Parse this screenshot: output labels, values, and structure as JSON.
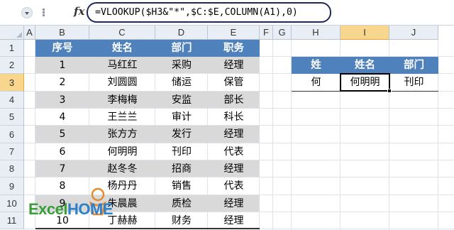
{
  "formula_bar": {
    "fx_label": "fx",
    "formula": "=VLOOKUP($H3&\"*\",$C:$E,COLUMN(A1),0)"
  },
  "columns": [
    "A",
    "B",
    "C",
    "D",
    "E",
    "F",
    "G",
    "H",
    "I",
    "J"
  ],
  "rows": [
    "1",
    "2",
    "3",
    "4",
    "5",
    "6",
    "7",
    "8",
    "9",
    "10",
    "11"
  ],
  "selected": {
    "column": "I",
    "row": "3"
  },
  "table": {
    "headers": [
      "序号",
      "姓名",
      "部门",
      "职务"
    ],
    "rows": [
      [
        "1",
        "马红红",
        "采购",
        "经理"
      ],
      [
        "2",
        "刘圆圆",
        "储运",
        "保管"
      ],
      [
        "3",
        "李梅梅",
        "安监",
        "部长"
      ],
      [
        "4",
        "王兰兰",
        "审计",
        "科长"
      ],
      [
        "5",
        "张方方",
        "发行",
        "经理"
      ],
      [
        "6",
        "何明明",
        "刊印",
        "代表"
      ],
      [
        "7",
        "赵冬冬",
        "招商",
        "经理"
      ],
      [
        "8",
        "杨丹丹",
        "销售",
        "代表"
      ],
      [
        "9",
        "朱晨晨",
        "质检",
        "经理"
      ],
      [
        "10",
        "丁赫赫",
        "财务",
        "经理"
      ]
    ]
  },
  "lookup": {
    "headers": [
      "姓",
      "姓名",
      "部门"
    ],
    "values": [
      "何",
      "何明明",
      "刊印"
    ]
  },
  "watermark": {
    "part1": "Excel",
    "part2": "HOME"
  },
  "colors": {
    "header_fill": "#4f81bd",
    "band_fill": "#d9d9d9",
    "selection_header": "#f8d68d",
    "formula_box_border": "#1f2a5a"
  }
}
